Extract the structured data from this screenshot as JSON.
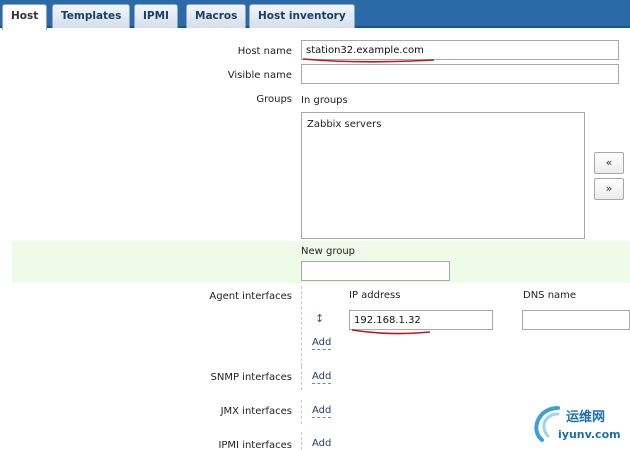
{
  "tabs": [
    {
      "label": "Host",
      "active": true
    },
    {
      "label": "Templates",
      "active": false
    },
    {
      "label": "IPMI",
      "active": false
    },
    {
      "label": "Macros",
      "active": false
    },
    {
      "label": "Host inventory",
      "active": false
    }
  ],
  "form": {
    "host_name_label": "Host name",
    "host_name_value": "station32.example.com",
    "visible_name_label": "Visible name",
    "visible_name_value": "",
    "groups_label": "Groups",
    "in_groups_label": "In groups",
    "in_groups_items": [
      "Zabbix servers"
    ],
    "move_left_label": "«",
    "move_right_label": "»",
    "new_group_label": "New group",
    "new_group_value": "",
    "agent_interfaces_label": "Agent interfaces",
    "ip_address_header": "IP address",
    "dns_name_header": "DNS name",
    "agent_ip_value": "192.168.1.32",
    "agent_dns_value": "",
    "agent_add_label": "Add",
    "snmp_interfaces_label": "SNMP interfaces",
    "snmp_add_label": "Add",
    "jmx_interfaces_label": "JMX interfaces",
    "jmx_add_label": "Add",
    "ipmi_interfaces_label": "IPMI interfaces",
    "ipmi_add_label": "Add"
  },
  "watermark": {
    "brand_cn": "运维网",
    "brand_url": "iyunv.com"
  },
  "colors": {
    "tabbar": "#2a6aa6",
    "highlight_band": "#edfbe8",
    "annotation_red": "#c0181e"
  }
}
